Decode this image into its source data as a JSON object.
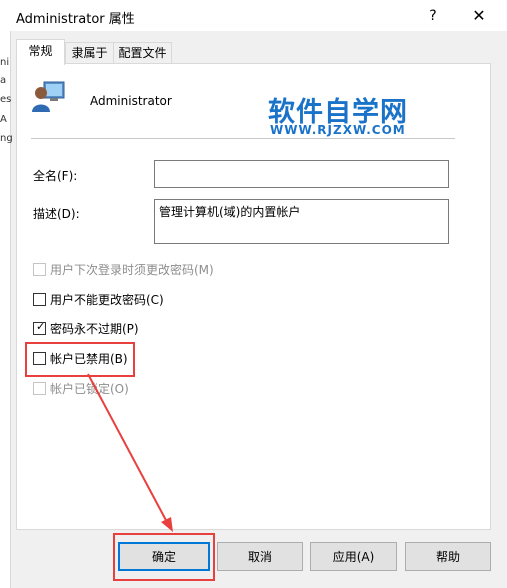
{
  "window": {
    "title": "Administrator 属性",
    "help_glyph": "?",
    "close_glyph": "✕"
  },
  "tabs": [
    {
      "label": "常规",
      "active": true
    },
    {
      "label": "隶属于",
      "active": false
    },
    {
      "label": "配置文件",
      "active": false
    }
  ],
  "general": {
    "user_name": "Administrator",
    "full_name_label": "全名(F):",
    "full_name_value": "",
    "description_label": "描述(D):",
    "description_value": "管理计算机(域)的内置帐户"
  },
  "checkboxes": [
    {
      "label": "用户下次登录时须更改密码(M)",
      "checked": false,
      "enabled": false
    },
    {
      "label": "用户不能更改密码(C)",
      "checked": false,
      "enabled": true
    },
    {
      "label": "密码永不过期(P)",
      "checked": true,
      "enabled": true
    },
    {
      "label": "帐户已禁用(B)",
      "checked": false,
      "enabled": true
    },
    {
      "label": "帐户已锁定(O)",
      "checked": false,
      "enabled": false
    }
  ],
  "buttons": {
    "ok": "确定",
    "cancel": "取消",
    "apply": "应用(A)",
    "help": "帮助"
  },
  "watermark": {
    "title": "软件自学网",
    "url": "WWW.RJZXW.COM"
  },
  "left_edge_chars": [
    "ni",
    "a",
    "es",
    "A",
    "ng"
  ],
  "colors": {
    "annotation_red": "#e8403e",
    "watermark_blue": "#1a73c9",
    "focus_blue": "#0078d7"
  }
}
